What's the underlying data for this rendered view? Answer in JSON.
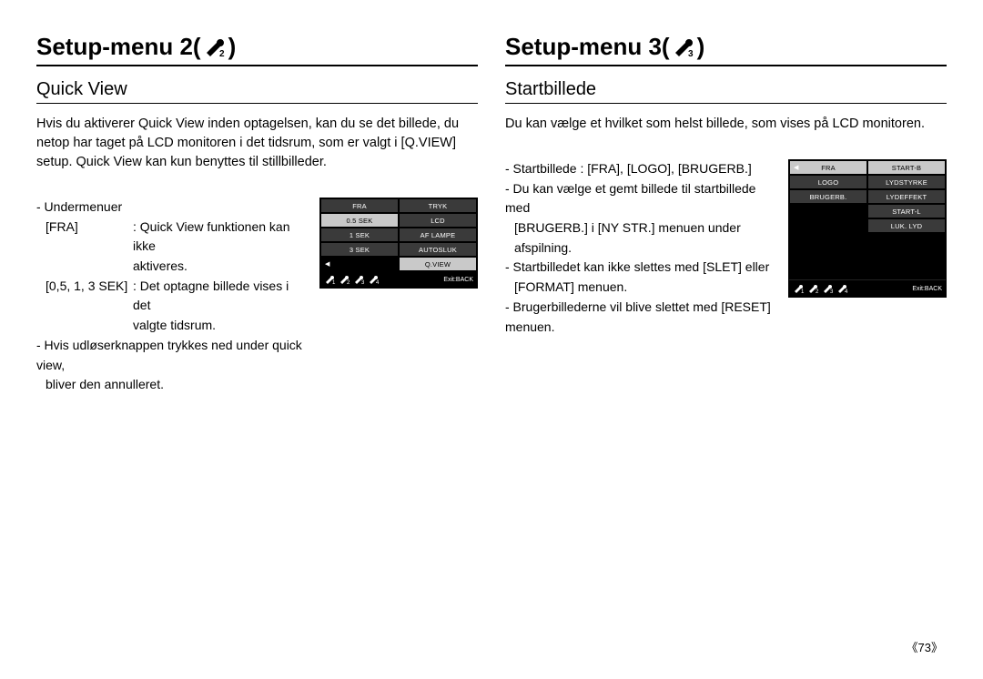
{
  "left": {
    "heading": "Setup-menu 2(",
    "heading_close": ")",
    "subheading": "Quick View",
    "intro": "Hvis du aktiverer Quick View inden optagelsen, kan du se det billede, du netop har taget på LCD monitoren i det tidsrum, som er valgt i [Q.VIEW] setup. Quick View kan kun benyttes til stillbilleder.",
    "l1": "- Undermenuer",
    "def1_term": "[FRA]",
    "def1_desc1": ": Quick View funktionen kan ikke",
    "def1_desc2": "aktiveres.",
    "def2_term": "[0,5, 1, 3 SEK]",
    "def2_desc1": ": Det optagne billede vises i det",
    "def2_desc2": "valgte tidsrum.",
    "l2": "- Hvis udløserknappen trykkes ned under quick view,",
    "l3": "bliver den annulleret.",
    "panel": {
      "left_items": [
        "FRA",
        "0.5 SEK",
        "1 SEK",
        "3 SEK",
        ""
      ],
      "right_items": [
        "TRYK",
        "LCD",
        "AF LAMPE",
        "AUTOSLUK",
        "Q.VIEW"
      ],
      "selected_left": 1,
      "arrow_row": 4,
      "exit": "Exit:BACK"
    }
  },
  "right": {
    "heading": "Setup-menu 3(",
    "heading_close": ")",
    "subheading": "Startbillede",
    "intro": "Du kan vælge et hvilket som helst billede, som vises på LCD monitoren.",
    "l1": "- Startbillede : [FRA], [LOGO], [BRUGERB.]",
    "l2": "- Du kan vælge et gemt billede til startbillede med",
    "l3": "[BRUGERB.] i [NY STR.] menuen under afspilning.",
    "l4": "- Startbilledet kan ikke slettes med [SLET] eller",
    "l5": "[FORMAT] menuen.",
    "l6": "- Brugerbillederne vil blive slettet med [RESET] menuen.",
    "panel": {
      "left_items": [
        "FRA",
        "LOGO",
        "BRUGERB."
      ],
      "right_items": [
        "START-B",
        "LYDSTYRKE",
        "LYDEFFEKT",
        "START-L",
        "LUK. LYD"
      ],
      "selected_left": 0,
      "arrow_row": 0,
      "exit": "Exit:BACK"
    }
  },
  "page_number": "《73》"
}
